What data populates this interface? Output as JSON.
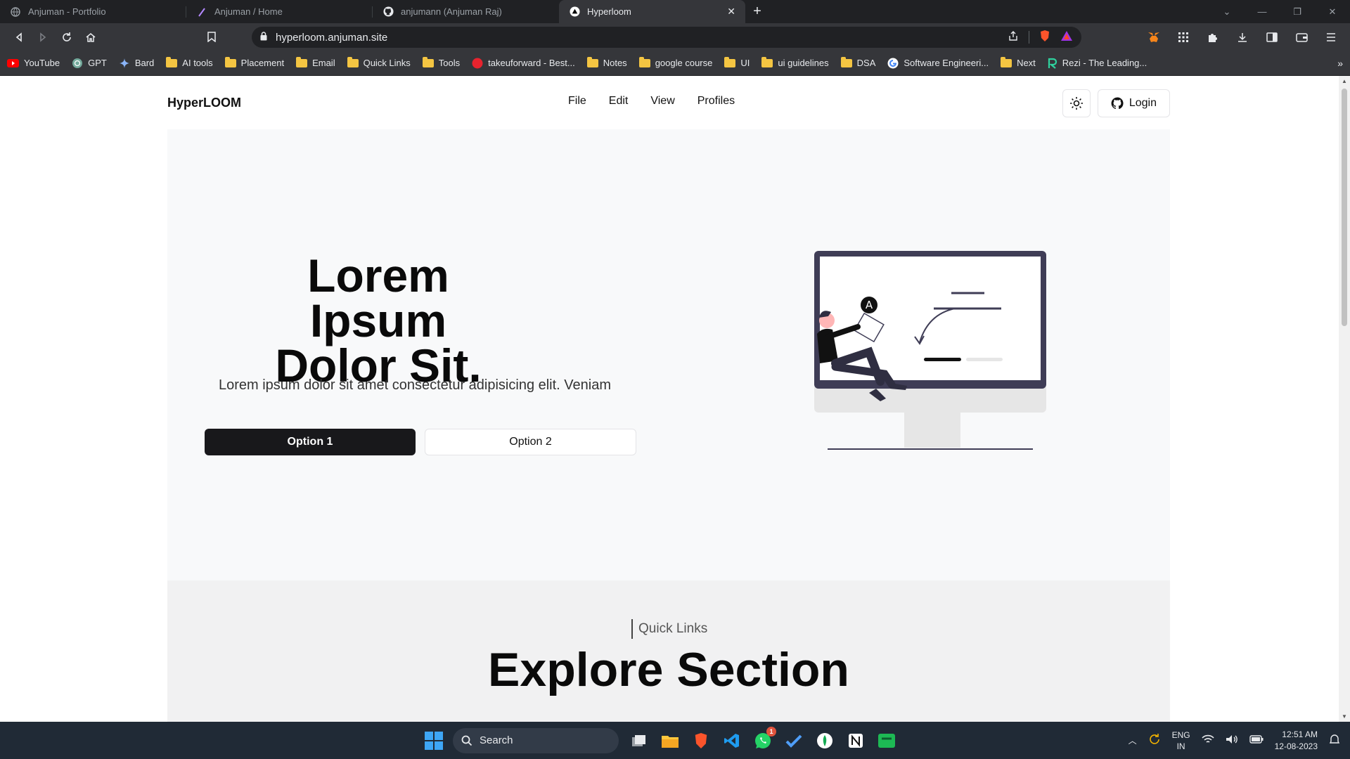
{
  "browser": {
    "tabs": [
      {
        "title": "Anjuman - Portfolio",
        "active": false
      },
      {
        "title": "Anjuman / Home",
        "active": false
      },
      {
        "title": "anjumann (Anjuman Raj)",
        "active": false
      },
      {
        "title": "Hyperloom",
        "active": true
      }
    ],
    "url": "hyperloom.anjuman.site",
    "bookmarks": [
      "YouTube",
      "GPT",
      "Bard",
      "AI tools",
      "Placement",
      "Email",
      "Quick Links",
      "Tools",
      "takeuforward - Best...",
      "Notes",
      "google course",
      "UI",
      "ui guidelines",
      "DSA",
      "Software Engineeri...",
      "Next",
      "Rezi - The Leading..."
    ]
  },
  "site": {
    "brand": "HyperLOOM",
    "menu": [
      "File",
      "Edit",
      "View",
      "Profiles"
    ],
    "login_label": "Login",
    "hero": {
      "title": "Lorem Ipsum Dolor Sit.",
      "subtitle": "Lorem ipsum dolor sit amet consectetur adipisicing elit. Veniam",
      "option1": "Option 1",
      "option2": "Option 2"
    },
    "explore": {
      "eyebrow": "Quick Links",
      "title": "Explore Section"
    }
  },
  "taskbar": {
    "search_label": "Search",
    "whatsapp_badge": "1",
    "lang_line1": "ENG",
    "lang_line2": "IN",
    "time": "12:51 AM",
    "date": "12-08-2023"
  },
  "colors": {
    "accent_dark": "#18181b",
    "hero_bg": "#f8f9fa",
    "monitor_frame": "#3f3d56"
  }
}
